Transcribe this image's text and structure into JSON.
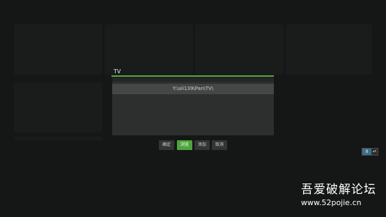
{
  "dialog": {
    "name_value": "TV",
    "paths": [
      "Y:\\ali139\\Pan\\TV\\"
    ],
    "buttons": {
      "ok_label": "确定",
      "browse_label": "浏览",
      "add_label": "添加",
      "cancel_label": "取消"
    }
  },
  "counter": {
    "value": "8",
    "arrows": "▴▾"
  },
  "watermark": {
    "title": "吾爱破解论坛",
    "url": "www.52pojie.cn"
  },
  "colors": {
    "accent": "#4ea53d",
    "input_underline": "#5eaa44",
    "background": "#1b1d1c"
  }
}
